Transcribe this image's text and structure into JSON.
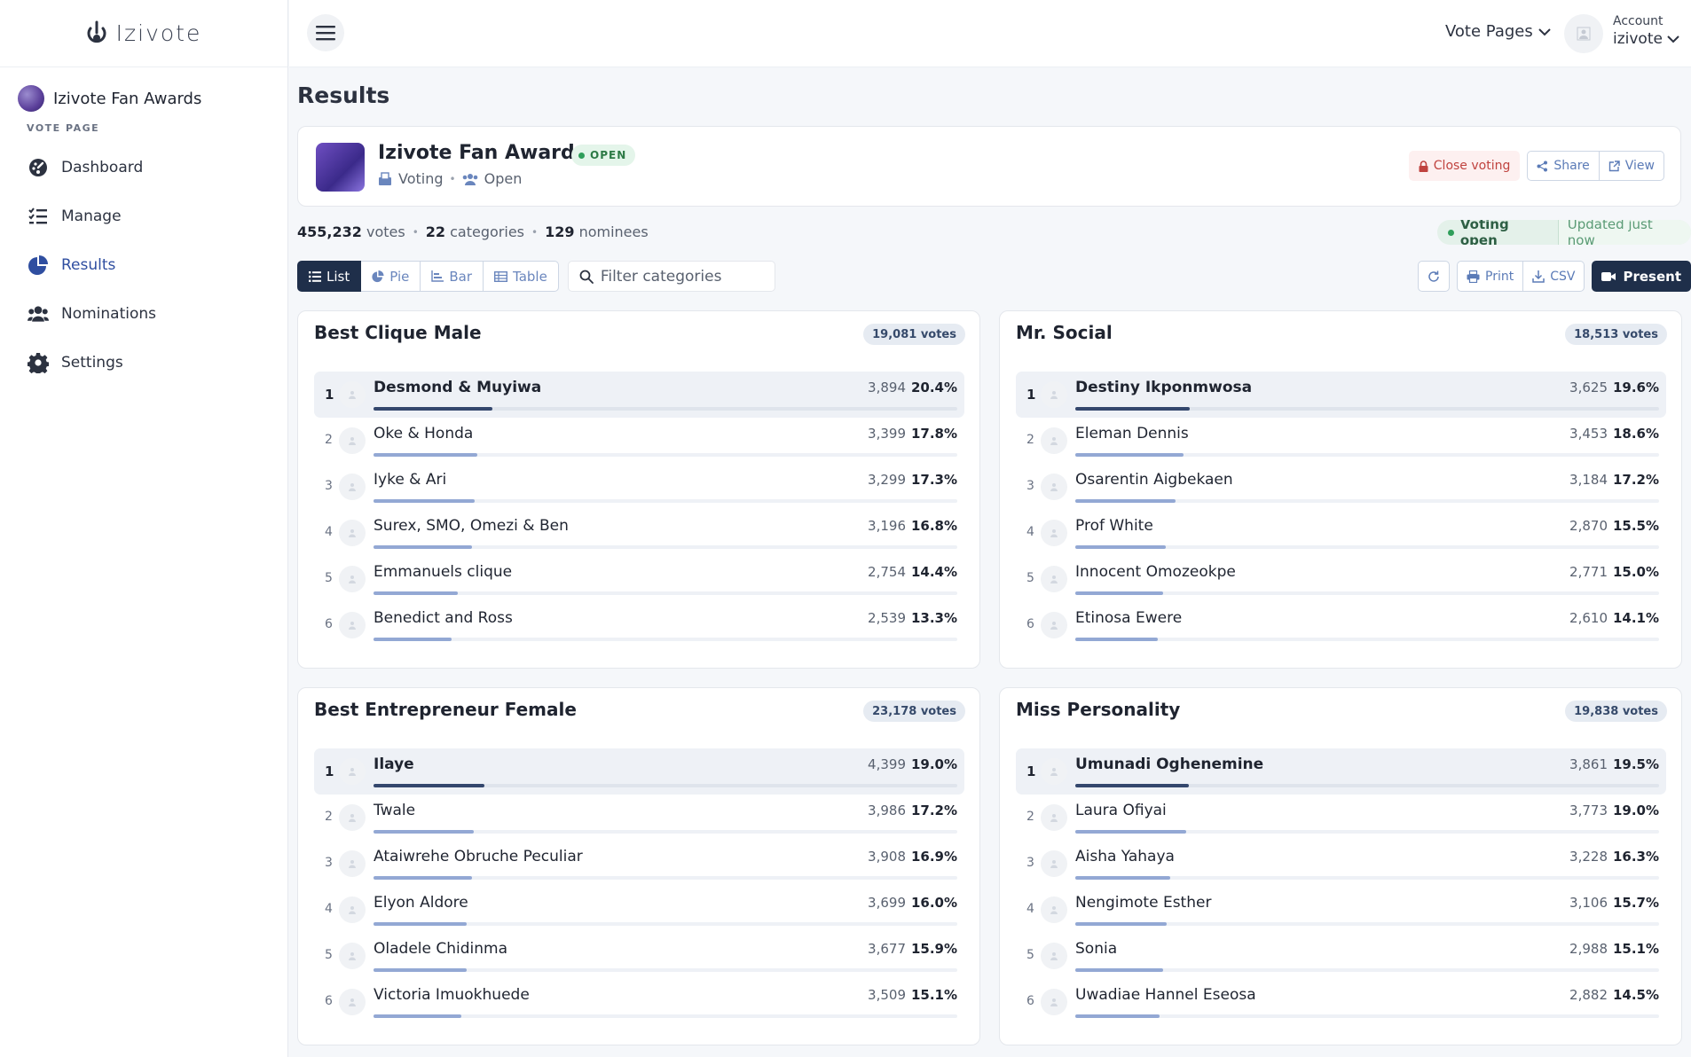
{
  "app": {
    "logo_text": "Izivote"
  },
  "sidebar": {
    "project_name": "Izivote Fan Awards",
    "project_sub": "VOTE PAGE",
    "items": [
      {
        "label": "Dashboard",
        "icon": "gauge-icon"
      },
      {
        "label": "Manage",
        "icon": "checklist-icon"
      },
      {
        "label": "Results",
        "icon": "pie-chart-icon"
      },
      {
        "label": "Nominations",
        "icon": "users-icon"
      },
      {
        "label": "Settings",
        "icon": "gear-icon"
      }
    ],
    "active": "Results"
  },
  "topbar": {
    "vote_pages": "Vote Pages",
    "account_label": "Account",
    "account_name": "izivote"
  },
  "page": {
    "title": "Results"
  },
  "event": {
    "title": "Izivote Fan Awards",
    "badge": "OPEN",
    "type": "Voting",
    "mode": "Open",
    "close_label": "Close voting",
    "share_label": "Share",
    "view_label": "View"
  },
  "stats": {
    "votes": "455,232",
    "votes_label": "votes",
    "categories": "22",
    "categories_label": "categories",
    "nominees": "129",
    "nominees_label": "nominees"
  },
  "status": {
    "state": "Voting open",
    "updated": "Updated just now"
  },
  "toolbar": {
    "tabs": [
      "List",
      "Pie",
      "Bar",
      "Table"
    ],
    "active_tab": "List",
    "filter_placeholder": "Filter categories",
    "print_label": "Print",
    "csv_label": "CSV",
    "present_label": "Present"
  },
  "colors": {
    "accent": "#1f2f4a",
    "bar_top": "#34476d",
    "bar": "#93a8d4",
    "open_green": "#2f9e5a",
    "danger": "#c0433f"
  },
  "categories": [
    {
      "title": "Best Clique Male",
      "total": "19,081 votes",
      "nominees": [
        {
          "rank": "1",
          "name": "Desmond & Muyiwa",
          "votes": "3,894",
          "pct": "20.4%",
          "share": 0.204
        },
        {
          "rank": "2",
          "name": "Oke & Honda",
          "votes": "3,399",
          "pct": "17.8%",
          "share": 0.178
        },
        {
          "rank": "3",
          "name": "Iyke & Ari",
          "votes": "3,299",
          "pct": "17.3%",
          "share": 0.173
        },
        {
          "rank": "4",
          "name": "Surex, SMO, Omezi & Ben",
          "votes": "3,196",
          "pct": "16.8%",
          "share": 0.168
        },
        {
          "rank": "5",
          "name": "Emmanuels clique",
          "votes": "2,754",
          "pct": "14.4%",
          "share": 0.144
        },
        {
          "rank": "6",
          "name": "Benedict and Ross",
          "votes": "2,539",
          "pct": "13.3%",
          "share": 0.133
        }
      ]
    },
    {
      "title": "Mr. Social",
      "total": "18,513 votes",
      "nominees": [
        {
          "rank": "1",
          "name": "Destiny Ikponmwosa",
          "votes": "3,625",
          "pct": "19.6%",
          "share": 0.196
        },
        {
          "rank": "2",
          "name": "Eleman Dennis",
          "votes": "3,453",
          "pct": "18.6%",
          "share": 0.186
        },
        {
          "rank": "3",
          "name": "Osarentin Aigbekaen",
          "votes": "3,184",
          "pct": "17.2%",
          "share": 0.172
        },
        {
          "rank": "4",
          "name": "Prof White",
          "votes": "2,870",
          "pct": "15.5%",
          "share": 0.155
        },
        {
          "rank": "5",
          "name": "Innocent Omozeokpe",
          "votes": "2,771",
          "pct": "15.0%",
          "share": 0.15
        },
        {
          "rank": "6",
          "name": "Etinosa Ewere",
          "votes": "2,610",
          "pct": "14.1%",
          "share": 0.141
        }
      ]
    },
    {
      "title": "Best Entrepreneur Female",
      "total": "23,178 votes",
      "nominees": [
        {
          "rank": "1",
          "name": "Ilaye",
          "votes": "4,399",
          "pct": "19.0%",
          "share": 0.19
        },
        {
          "rank": "2",
          "name": "Twale",
          "votes": "3,986",
          "pct": "17.2%",
          "share": 0.172
        },
        {
          "rank": "3",
          "name": "Ataiwrehe Obruche Peculiar",
          "votes": "3,908",
          "pct": "16.9%",
          "share": 0.169
        },
        {
          "rank": "4",
          "name": "Elyon Aldore",
          "votes": "3,699",
          "pct": "16.0%",
          "share": 0.16
        },
        {
          "rank": "5",
          "name": "Oladele Chidinma",
          "votes": "3,677",
          "pct": "15.9%",
          "share": 0.159
        },
        {
          "rank": "6",
          "name": "Victoria Imuokhuede",
          "votes": "3,509",
          "pct": "15.1%",
          "share": 0.151
        }
      ]
    },
    {
      "title": "Miss Personality",
      "total": "19,838 votes",
      "nominees": [
        {
          "rank": "1",
          "name": "Umunadi Oghenemine",
          "votes": "3,861",
          "pct": "19.5%",
          "share": 0.195
        },
        {
          "rank": "2",
          "name": "Laura Ofiyai",
          "votes": "3,773",
          "pct": "19.0%",
          "share": 0.19
        },
        {
          "rank": "3",
          "name": "Aisha Yahaya",
          "votes": "3,228",
          "pct": "16.3%",
          "share": 0.163
        },
        {
          "rank": "4",
          "name": "Nengimote Esther",
          "votes": "3,106",
          "pct": "15.7%",
          "share": 0.157
        },
        {
          "rank": "5",
          "name": "Sonia",
          "votes": "2,988",
          "pct": "15.1%",
          "share": 0.151
        },
        {
          "rank": "6",
          "name": "Uwadiae Hannel Eseosa",
          "votes": "2,882",
          "pct": "14.5%",
          "share": 0.145
        }
      ]
    }
  ]
}
